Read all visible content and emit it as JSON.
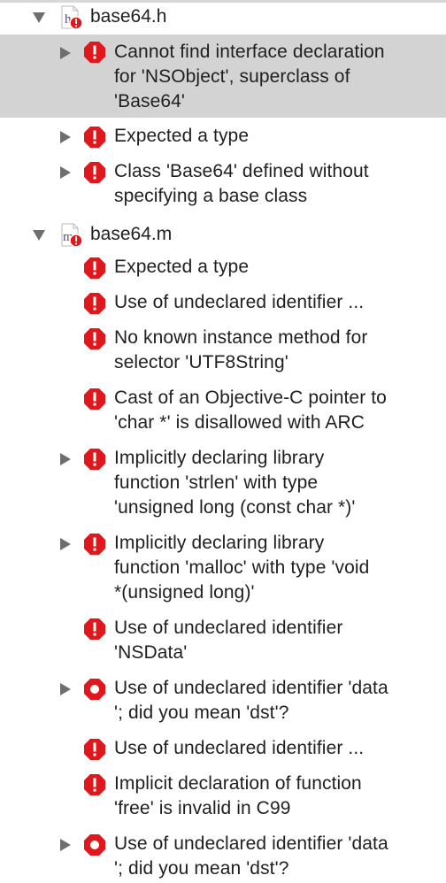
{
  "colors": {
    "error_red": "#e0181e",
    "selected_bg": "#d3d3d3",
    "triangle": "#6e6e6e",
    "text": "#1f1f1f"
  },
  "files": [
    {
      "name": "base64.h",
      "icon": "header-file-icon",
      "icon_letter": "h",
      "expanded": true
    },
    {
      "name": "base64.m",
      "icon": "implementation-file-icon",
      "icon_letter": "m",
      "expanded": true
    }
  ],
  "issues_h": [
    {
      "text": "Cannot find interface declaration\nfor 'NSObject', superclass of\n'Base64'",
      "selected": true,
      "expandable": true,
      "icon": "error-octagon-icon"
    },
    {
      "text": "Expected a type",
      "selected": false,
      "expandable": true,
      "icon": "error-octagon-icon"
    },
    {
      "text": "Class 'Base64' defined without\nspecifying a base class",
      "selected": false,
      "expandable": true,
      "icon": "error-octagon-icon"
    }
  ],
  "issues_m": [
    {
      "text": "Expected a type",
      "expandable": false,
      "icon": "error-octagon-icon"
    },
    {
      "text": "Use of undeclared identifier ...",
      "expandable": false,
      "icon": "error-octagon-icon"
    },
    {
      "text": "No known instance method for\nselector 'UTF8String'",
      "expandable": false,
      "icon": "error-octagon-icon"
    },
    {
      "text": "Cast of an Objective-C pointer to\n'char *' is disallowed with ARC",
      "expandable": false,
      "icon": "error-octagon-icon"
    },
    {
      "text": "Implicitly declaring library\nfunction 'strlen' with type\n'unsigned long (const char *)'",
      "expandable": true,
      "icon": "error-octagon-icon"
    },
    {
      "text": "Implicitly declaring library\nfunction 'malloc' with type 'void\n*(unsigned long)'",
      "expandable": true,
      "icon": "error-octagon-icon"
    },
    {
      "text": "Use of undeclared identifier\n'NSData'",
      "expandable": false,
      "icon": "error-octagon-icon"
    },
    {
      "text": "Use of undeclared identifier 'data\n'; did you mean 'dst'?",
      "expandable": true,
      "icon": "fixit-error-icon"
    },
    {
      "text": "Use of undeclared identifier ...",
      "expandable": false,
      "icon": "error-octagon-icon"
    },
    {
      "text": "Implicit declaration of function\n'free' is invalid in C99",
      "expandable": false,
      "icon": "error-octagon-icon"
    },
    {
      "text": "Use of undeclared identifier 'data\n'; did you mean 'dst'?",
      "expandable": true,
      "icon": "fixit-error-icon"
    }
  ]
}
